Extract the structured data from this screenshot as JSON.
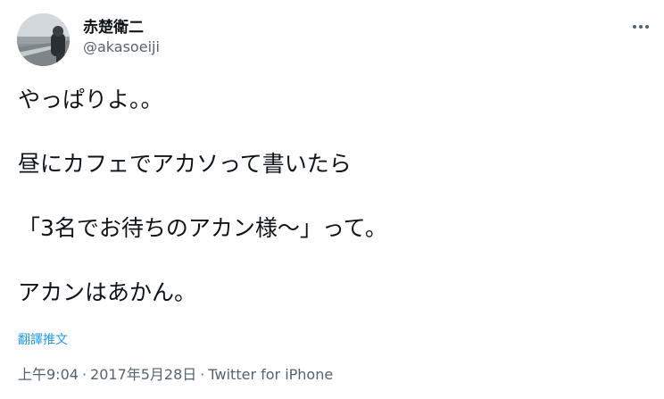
{
  "user": {
    "display_name": "赤楚衛二",
    "handle": "@akasoeiji"
  },
  "more_icon": "more-horizontal-icon",
  "tweet": {
    "lines": [
      "やっぱりよ。。",
      "",
      "昼にカフェでアカソって書いたら",
      "",
      "「3名でお待ちのアカン様〜」って。",
      "",
      "アカンはあかん。"
    ]
  },
  "translate_label": "翻譯推文",
  "meta": {
    "time": "上午9:04",
    "separator": "·",
    "date": "2017年5月28日",
    "source": "Twitter for iPhone"
  },
  "colors": {
    "text": "#0f1419",
    "secondary": "#536471",
    "link": "#1d9bf0"
  }
}
